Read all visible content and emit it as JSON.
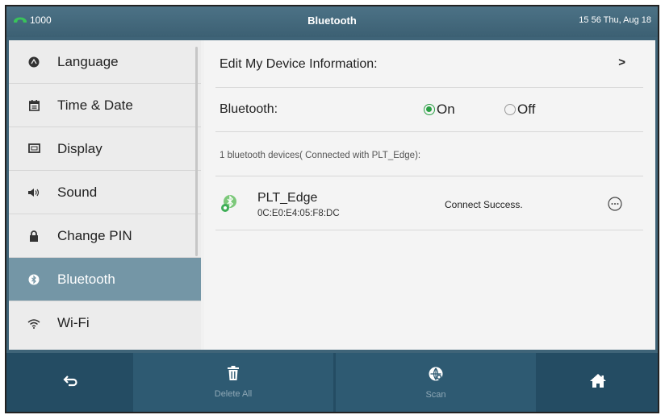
{
  "status_bar": {
    "account": "1000",
    "title": "Bluetooth",
    "datetime": "15 56 Thu, Aug 18"
  },
  "sidebar": {
    "items": [
      {
        "label": "Language",
        "icon": "language-icon"
      },
      {
        "label": "Time & Date",
        "icon": "calendar-icon"
      },
      {
        "label": "Display",
        "icon": "display-icon"
      },
      {
        "label": "Sound",
        "icon": "speaker-icon"
      },
      {
        "label": "Change PIN",
        "icon": "lock-icon"
      },
      {
        "label": "Bluetooth",
        "icon": "bluetooth-icon",
        "active": true
      },
      {
        "label": "Wi-Fi",
        "icon": "wifi-icon"
      }
    ]
  },
  "main": {
    "edit_device_label": "Edit My Device Information:",
    "edit_device_chevron": ">",
    "bluetooth_label": "Bluetooth:",
    "on_label": "On",
    "off_label": "Off",
    "selected": "On",
    "devices_summary": "1 bluetooth devices( Connected with  PLT_Edge):",
    "device": {
      "name": "PLT_Edge",
      "mac": "0C:E0:E4:05:F8:DC",
      "status": "Connect Success."
    }
  },
  "softkeys": {
    "delete_all": "Delete All",
    "scan": "Scan"
  },
  "colors": {
    "accent_green": "#2aa044",
    "active_sidebar": "#7496a6",
    "softkey_bar": "#244c63"
  }
}
